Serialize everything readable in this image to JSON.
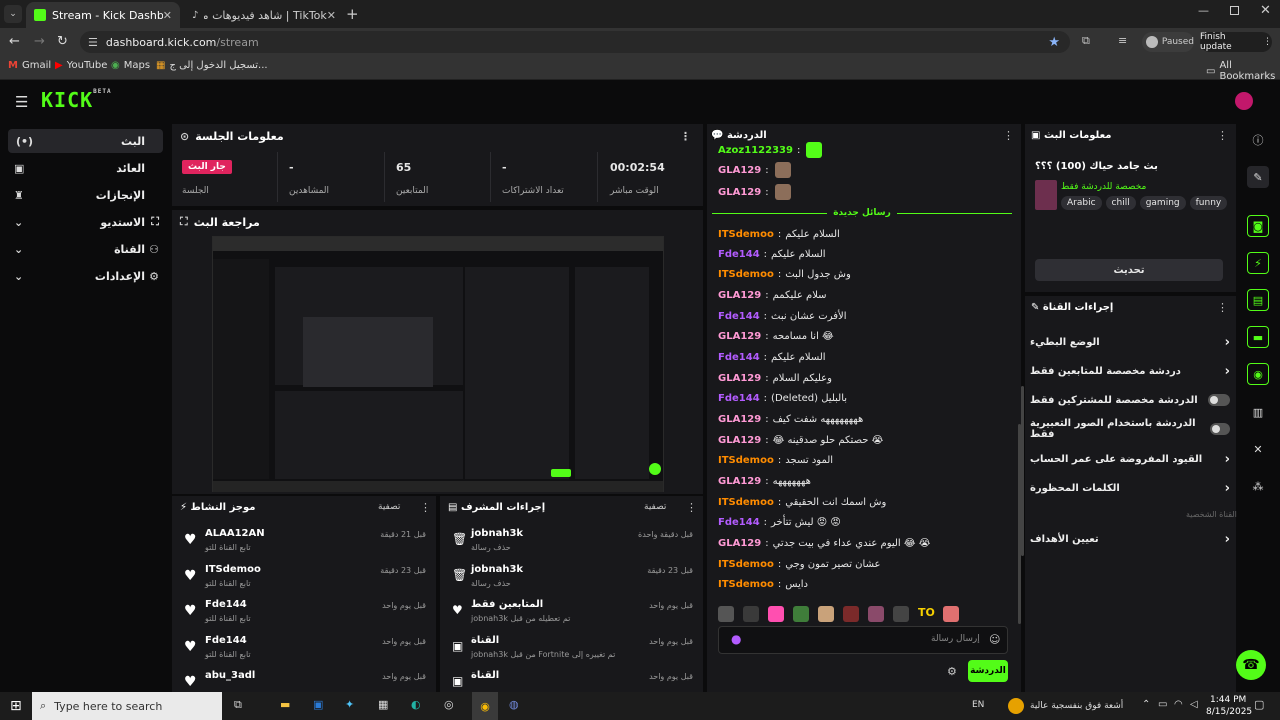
{
  "browser": {
    "tabs": [
      {
        "label": "Stream - Kick Dashboard"
      },
      {
        "label": "TikTok | شاهد فيديوهات متصدرة"
      }
    ],
    "url_host": "dashboard.kick.com",
    "url_path": "/stream",
    "paused_label": "Paused",
    "finish_update_label": "Finish update",
    "bookmarks": [
      "Gmail",
      "YouTube",
      "Maps",
      "تسجيل الدخول إلى ج..."
    ],
    "all_bookmarks_label": "All Bookmarks"
  },
  "app": {
    "logo": "KICK",
    "logo_badge": "BETA",
    "nav": [
      {
        "label": "البث"
      },
      {
        "label": "العائد"
      },
      {
        "label": "الإنجازات"
      },
      {
        "label": "الاستديو"
      },
      {
        "label": "القناة"
      },
      {
        "label": "الإعدادات"
      }
    ]
  },
  "session": {
    "title": "معلومات الجلسة",
    "live_badge": "جار البث",
    "stats": [
      {
        "label": "الجلسة",
        "value": ""
      },
      {
        "label": "المشاهدين",
        "value": "-"
      },
      {
        "label": "المتابعين",
        "value": "65"
      },
      {
        "label": "تعداد الاشتراكات",
        "value": "-"
      },
      {
        "label": "الوقت مباشر",
        "value": "00:02:54"
      }
    ]
  },
  "preview": {
    "title": "مراجعة البث"
  },
  "activity": {
    "title": "موجز النشاط",
    "filter_label": "تصفية",
    "items": [
      {
        "name": "ALAA12AN",
        "sub": "تابع القناة للتو",
        "time": "قبل 21 دقيقة"
      },
      {
        "name": "ITSdemoo",
        "sub": "تابع القناة للتو",
        "time": "قبل 23 دقيقة"
      },
      {
        "name": "Fde144",
        "sub": "تابع القناة للتو",
        "time": "قبل يوم واحد"
      },
      {
        "name": "Fde144",
        "sub": "تابع القناة للتو",
        "time": "قبل يوم واحد"
      },
      {
        "name": "abu_3adl",
        "sub": "",
        "time": "قبل يوم واحد"
      }
    ]
  },
  "modactions": {
    "title": "إجراءات المشرف",
    "filter_label": "تصفية",
    "items": [
      {
        "name": "jobnah3k",
        "sub": "حذف رسالة",
        "time": "قبل دقيقة واحدة"
      },
      {
        "name": "jobnah3k",
        "sub": "حذف رسالة",
        "time": "قبل 23 دقيقة"
      },
      {
        "name": "المتابعين فقط",
        "sub": "تم تعطيله من قبل jobnah3k",
        "time": "قبل يوم واحد"
      },
      {
        "name": "القناة",
        "sub": "تم تغييره إلى Fortnite من قبل jobnah3k",
        "time": "قبل يوم واحد"
      },
      {
        "name": "القناة",
        "sub": "",
        "time": "قبل يوم واحد"
      }
    ]
  },
  "chat": {
    "title": "الدردشة",
    "divider": "رسائل جديدة",
    "input_placeholder": "إرسال رسالة",
    "send_label": "الدردشة",
    "lines": [
      {
        "user": "Azoz1122339",
        "text": "",
        "color": "#53fc18"
      },
      {
        "user": "GLA129",
        "text": "",
        "color": "#ff9ad5"
      },
      {
        "user": "GLA129",
        "text": "",
        "color": "#ff9ad5"
      },
      {
        "user": "ITSdemoo",
        "text": "السلام عليكم",
        "color": "#ff8c00"
      },
      {
        "user": "Fde144",
        "text": "السلام عليكم",
        "color": "#b35cff"
      },
      {
        "user": "ITSdemoo",
        "text": "وش جدول البث",
        "color": "#ff8c00"
      },
      {
        "user": "GLA129",
        "text": "سلام عليكمم",
        "color": "#ff9ad5"
      },
      {
        "user": "Fde144",
        "text": "الأفرت عشان نبث",
        "color": "#b35cff"
      },
      {
        "user": "GLA129",
        "text": "😂 انا مسامحه",
        "color": "#ff9ad5"
      },
      {
        "user": "Fde144",
        "text": "السلام عليكم",
        "color": "#b35cff"
      },
      {
        "user": "GLA129",
        "text": "وعليكم السلام",
        "color": "#ff9ad5"
      },
      {
        "user": "Fde144",
        "text": "بالبليل (Deleted)",
        "color": "#b35cff"
      },
      {
        "user": "GLA129",
        "text": "ههههههههه شفت كيف",
        "color": "#ff9ad5"
      },
      {
        "user": "GLA129",
        "text": "😭 حصتكم حلو صدقينه 😂",
        "color": "#ff9ad5"
      },
      {
        "user": "ITSdemoo",
        "text": "المود تسجد",
        "color": "#ff8c00"
      },
      {
        "user": "GLA129",
        "text": "هههههههه",
        "color": "#ff9ad5"
      },
      {
        "user": "ITSdemoo",
        "text": "وش اسمك انت الحقيقي",
        "color": "#ff8c00"
      },
      {
        "user": "Fde144",
        "text": "😡 😡 ليش تتأخر",
        "color": "#b35cff"
      },
      {
        "user": "GLA129",
        "text": "😭 😂 اليوم عندي عداء في بيت جدتي",
        "color": "#ff9ad5"
      },
      {
        "user": "ITSdemoo",
        "text": "عشان تصير تمون وجي",
        "color": "#ff8c00"
      },
      {
        "user": "ITSdemoo",
        "text": "دايس",
        "color": "#ff8c00"
      }
    ]
  },
  "streaminfo": {
    "title": "معلومات البث",
    "stream_title": "بث جامد حياك (100) ؟؟؟",
    "category": "مخصصة للدردشة فقط",
    "tags": [
      "Arabic",
      "chill",
      "gaming",
      "funny"
    ],
    "edit_label": "تحديث"
  },
  "channelactions": {
    "title": "إجراءات القناة",
    "items": [
      {
        "label": "الوضع البطيء",
        "type": "arrow"
      },
      {
        "label": "دردشة مخصصة للمتابعين فقط",
        "type": "arrow"
      },
      {
        "label": "الدردشة مخصصة للمشتركين فقط",
        "type": "toggle"
      },
      {
        "label": "الدردشة باستخدام الصور التعبيرية فقط",
        "type": "toggle"
      },
      {
        "label": "القيود المفروضة على عمر الحساب",
        "type": "arrow"
      },
      {
        "label": "الكلمات المحظورة",
        "type": "arrow"
      }
    ],
    "custom_label": "القناة الشخصية",
    "goals_label": "تعيين الأهداف"
  },
  "taskbar": {
    "search_placeholder": "Type here to search",
    "lang": "EN",
    "weather": "أشعة فوق بنفسجية عالية",
    "time": "1:44 PM",
    "date": "8/15/2025"
  },
  "colors": {
    "accent": "#53fc18",
    "live": "#e0245e"
  }
}
